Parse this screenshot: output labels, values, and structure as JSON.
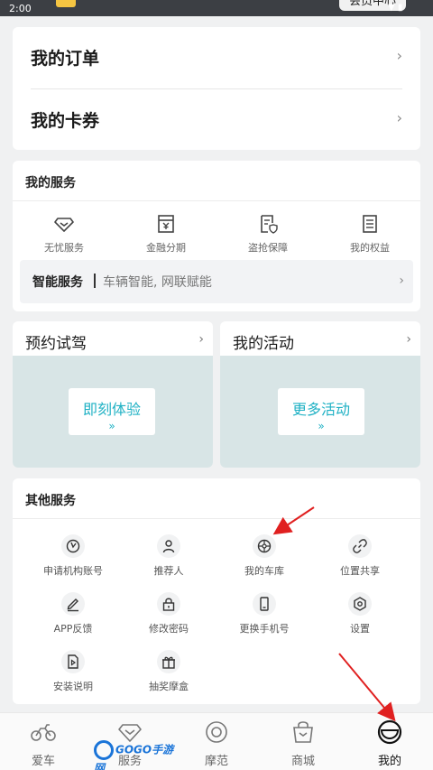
{
  "status_bar": {
    "time": "2:00",
    "member_label": "会员中心"
  },
  "orders": [
    {
      "label": "我的订单"
    },
    {
      "label": "我的卡券"
    }
  ],
  "my_services": {
    "title": "我的服务",
    "items": [
      {
        "label": "无忧服务",
        "icon": "diamond-icon"
      },
      {
        "label": "金融分期",
        "icon": "finance-icon"
      },
      {
        "label": "盗抢保障",
        "icon": "shield-doc-icon"
      },
      {
        "label": "我的权益",
        "icon": "list-doc-icon"
      }
    ],
    "smart": {
      "title": "智能服务",
      "desc": "车辆智能, 网联赋能"
    }
  },
  "test_drive": {
    "title": "预约试驾",
    "button": "即刻体验",
    "arrows": "»"
  },
  "activities": {
    "title": "我的活动",
    "button": "更多活动",
    "arrows": "»"
  },
  "other_services": {
    "title": "其他服务",
    "items": [
      {
        "label": "申请机构账号",
        "icon": "clock-check-icon"
      },
      {
        "label": "推荐人",
        "icon": "person-icon"
      },
      {
        "label": "我的车库",
        "icon": "wheel-icon"
      },
      {
        "label": "位置共享",
        "icon": "link-icon"
      },
      {
        "label": "APP反馈",
        "icon": "pen-icon"
      },
      {
        "label": "修改密码",
        "icon": "lock-icon"
      },
      {
        "label": "更换手机号",
        "icon": "phone-icon"
      },
      {
        "label": "设置",
        "icon": "hexagon-gear-icon"
      },
      {
        "label": "安装说明",
        "icon": "play-doc-icon"
      },
      {
        "label": "抽奖摩盒",
        "icon": "gift-icon"
      }
    ]
  },
  "bottom_nav": [
    {
      "label": "爱车",
      "icon": "motorcycle-icon"
    },
    {
      "label": "服务",
      "icon": "diamond-icon"
    },
    {
      "label": "摩范",
      "icon": "target-icon"
    },
    {
      "label": "商城",
      "icon": "bag-icon"
    },
    {
      "label": "我的",
      "icon": "helmet-icon",
      "active": true
    }
  ],
  "watermark": "GOGO手游网",
  "colors": {
    "accent": "#1fb1c4",
    "card_area": "#d8e5e6",
    "background": "#f0f1f2",
    "annotation": "#e02020"
  }
}
